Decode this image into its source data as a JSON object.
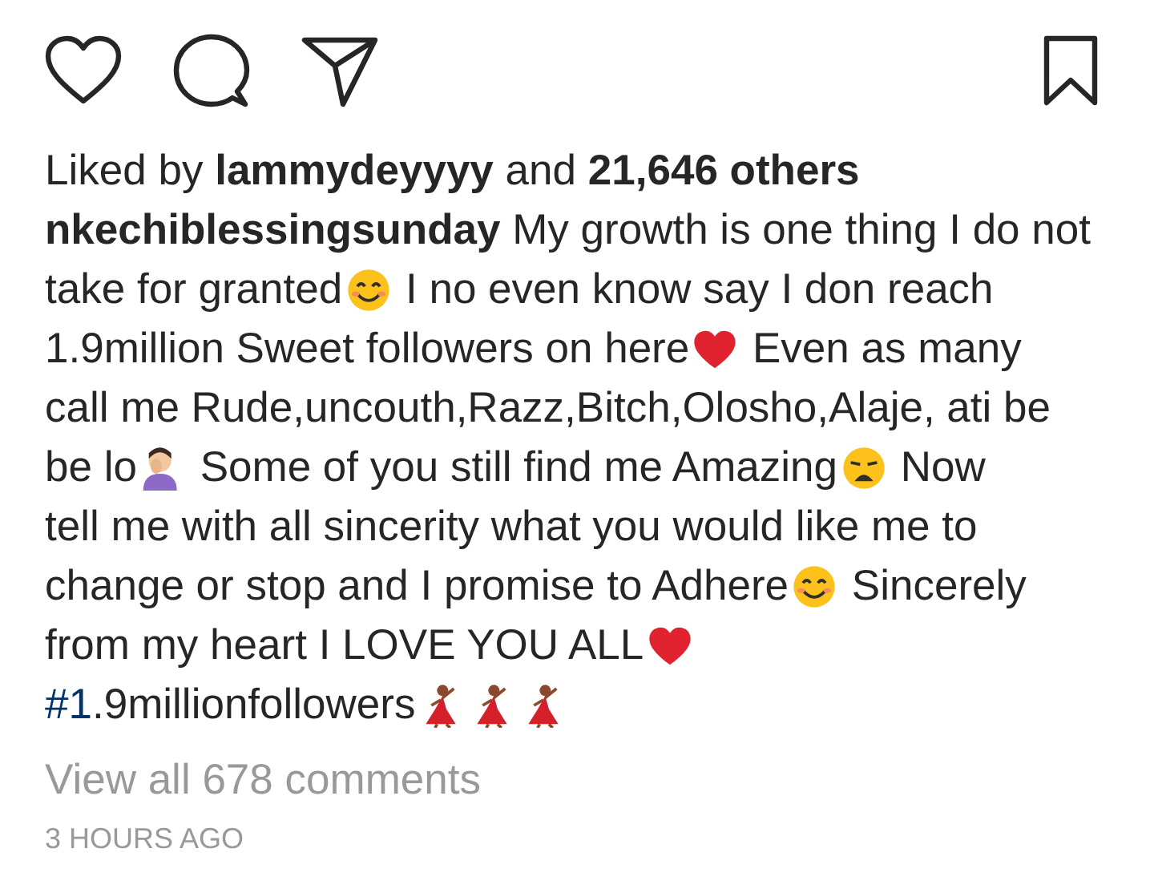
{
  "likes": {
    "text": "Liked by **lammydeyyyy** and **21,646 others**"
  },
  "caption": {
    "lines": [
      [
        {
          "kind": "text",
          "text": "**nkechiblessingsunday** My growth is one thing I do not"
        }
      ],
      [
        {
          "kind": "text",
          "text": "take for granted"
        },
        {
          "kind": "smile"
        },
        {
          "kind": "text",
          "text": " I no even know say I don reach"
        }
      ],
      [
        {
          "kind": "text",
          "text": "1.9million Sweet followers on here"
        },
        {
          "kind": "heart"
        },
        {
          "kind": "text",
          "text": " Even as many"
        }
      ],
      [
        {
          "kind": "text",
          "text": "call me Rude,uncouth,Razz,Bitch,Olosho,Alaje, ati be"
        }
      ],
      [
        {
          "kind": "text",
          "text": "be lo"
        },
        {
          "kind": "facepalm"
        },
        {
          "kind": "text",
          "text": " Some of you still find me Amazing"
        },
        {
          "kind": "weary"
        },
        {
          "kind": "text",
          "text": " Now"
        }
      ],
      [
        {
          "kind": "text",
          "text": "tell me with all sincerity what you would like me to"
        }
      ],
      [
        {
          "kind": "text",
          "text": "change or stop and I promise to Adhere"
        },
        {
          "kind": "smile"
        },
        {
          "kind": "text",
          "text": " Sincerely"
        }
      ],
      [
        {
          "kind": "text",
          "text": "from my heart I LOVE YOU ALL"
        },
        {
          "kind": "heart"
        }
      ],
      [
        {
          "kind": "hashtag",
          "text": "#1"
        },
        {
          "kind": "text",
          "text": ".9millionfollowers"
        },
        {
          "kind": "dancer"
        },
        {
          "kind": "dancer"
        },
        {
          "kind": "dancer"
        }
      ]
    ]
  },
  "view_comments": "View all 678 comments",
  "timestamp": "3 HOURS AGO"
}
